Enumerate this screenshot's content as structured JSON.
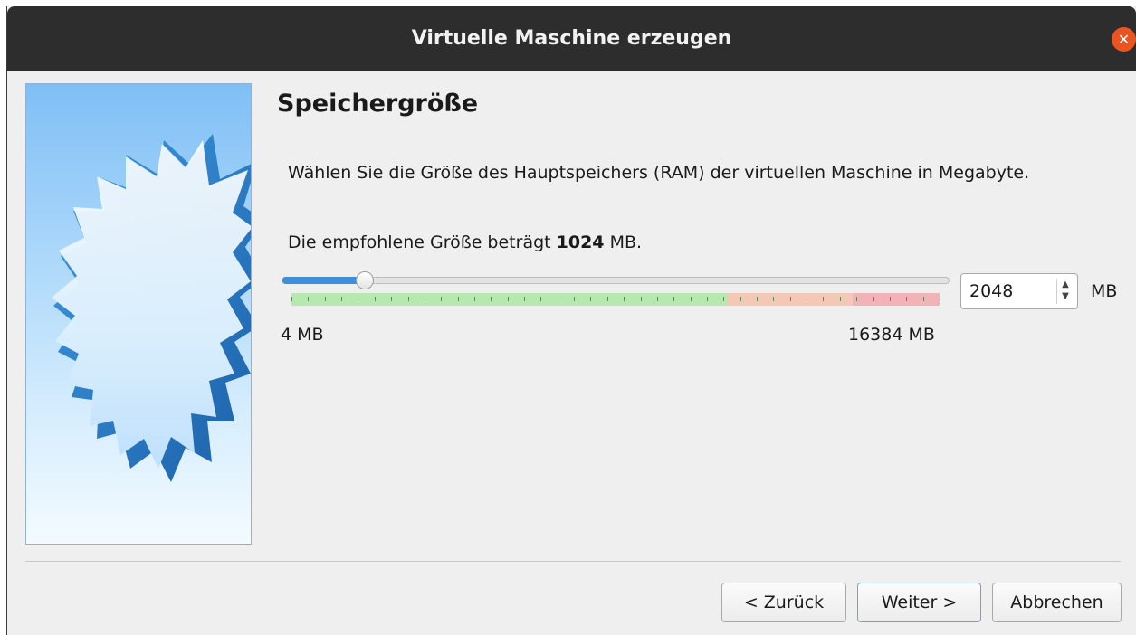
{
  "window": {
    "title": "Virtuelle Maschine erzeugen",
    "close_icon": "close-icon"
  },
  "page": {
    "heading": "Speichergröße",
    "description": "Wählen Sie die Größe des Hauptspeichers (RAM) der virtuellen Maschine in Megabyte.",
    "recommend_prefix": "Die empfohlene Größe beträgt ",
    "recommend_value": "1024",
    "recommend_suffix": " MB."
  },
  "memory": {
    "min_label": "4 MB",
    "max_label": "16384 MB",
    "value": "2048",
    "unit": "MB",
    "min": 4,
    "max": 16384,
    "current": 2048,
    "zone_colors": {
      "safe": "#b6e8b0",
      "warning": "#f3c8b5",
      "danger": "#f1b3b8"
    }
  },
  "buttons": {
    "back": "< Zurück",
    "next": "Weiter >",
    "cancel": "Abbrechen"
  },
  "colors": {
    "accent": "#e95420",
    "slider_fill": "#3d8fd9",
    "titlebar": "#2d2d2d"
  }
}
